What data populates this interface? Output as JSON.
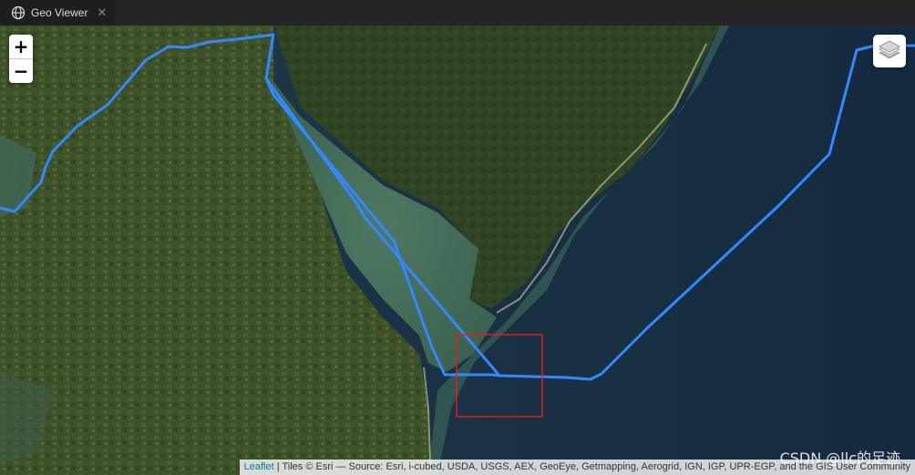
{
  "window": {
    "tab_title": "Geo Viewer",
    "tab_icon": "globe-icon",
    "close_symbol": "✕"
  },
  "map": {
    "zoom_in_label": "+",
    "zoom_out_label": "−",
    "layers_icon": "layers-icon",
    "route_color": "#3388ff",
    "highlight_color": "#e01e1e",
    "attribution": {
      "link_text": "Leaflet",
      "separator": " | ",
      "text": "Tiles © Esri — Source: Esri, i-cubed, USDA, USGS, AEX, GeoEye, Getmapping, Aerogrid, IGN, IGP, UPR-EGP, and the GIS User Community"
    }
  },
  "watermark": "CSDN @llc的足迹"
}
